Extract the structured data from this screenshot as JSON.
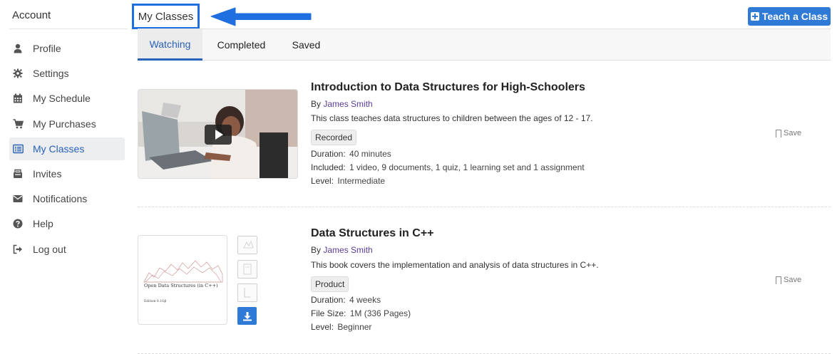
{
  "sidebar": {
    "title": "Account",
    "items": [
      {
        "label": "Profile",
        "icon": "user-icon"
      },
      {
        "label": "Settings",
        "icon": "gear-icon"
      },
      {
        "label": "My Schedule",
        "icon": "calendar-icon"
      },
      {
        "label": "My Purchases",
        "icon": "cart-icon"
      },
      {
        "label": "My Classes",
        "icon": "list-icon",
        "active": true
      },
      {
        "label": "Invites",
        "icon": "inbox-icon"
      },
      {
        "label": "Notifications",
        "icon": "envelope-icon"
      },
      {
        "label": "Help",
        "icon": "question-icon"
      },
      {
        "label": "Log out",
        "icon": "logout-icon"
      }
    ]
  },
  "header": {
    "title": "My Classes",
    "teach_button": "Teach a Class"
  },
  "tabs": [
    {
      "label": "Watching",
      "active": true
    },
    {
      "label": "Completed"
    },
    {
      "label": "Saved"
    }
  ],
  "classes": [
    {
      "title": "Introduction to Data Structures for High-Schoolers",
      "by": "By",
      "author": "James Smith",
      "description": "This class teaches data structures to children between the ages of 12 - 17.",
      "badge": "Recorded",
      "meta": [
        {
          "key": "Duration:",
          "value": "40 minutes"
        },
        {
          "key": "Included:",
          "value": "1 video, 9 documents, 1 quiz, 1 learning set and 1 assignment"
        },
        {
          "key": "Level:",
          "value": "Intermediate"
        }
      ],
      "save_label": "Save"
    },
    {
      "title": "Data Structures in C++",
      "by": "By",
      "author": "James Smith",
      "description": "This book covers the implementation and analysis of data structures in C++.",
      "badge": "Product",
      "meta": [
        {
          "key": "Duration:",
          "value": "4 weeks"
        },
        {
          "key": "File Size:",
          "value": "1M (336 Pages)"
        },
        {
          "key": "Level:",
          "value": "Beginner"
        }
      ],
      "save_label": "Save",
      "cover_title": "Open Data Structures (in C++)",
      "cover_edition": "Edition 0.1Gβ"
    }
  ],
  "colors": {
    "accent": "#2a62b8",
    "button": "#2e7ad6",
    "annotation": "#1f6fe0",
    "author_link": "#5a3d96"
  }
}
